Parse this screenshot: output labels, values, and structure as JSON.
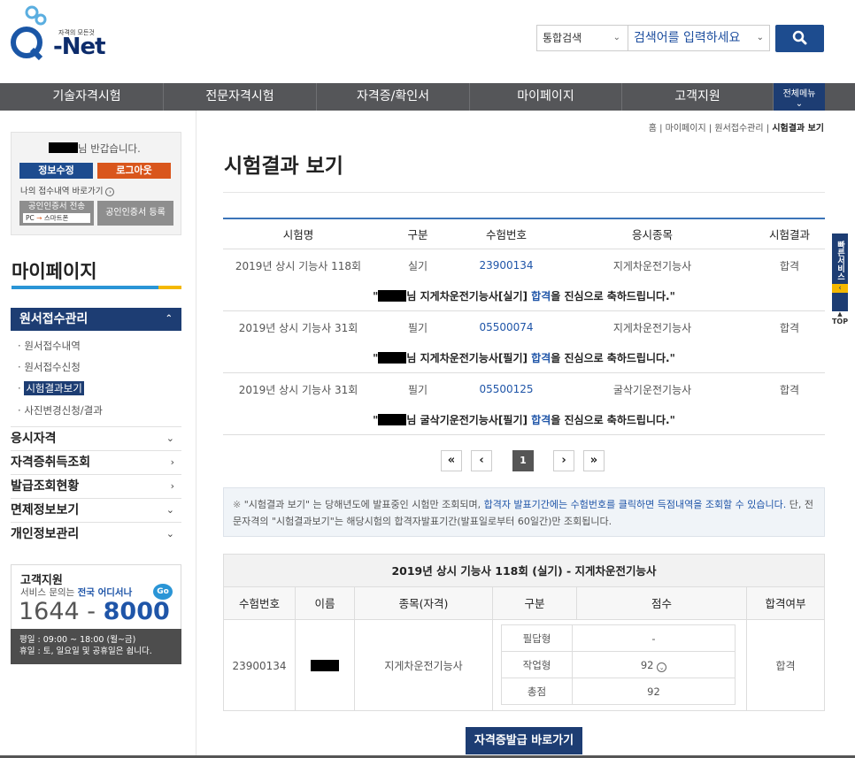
{
  "header": {
    "logo_tag": "자격의 모든것",
    "logo_q": "Q",
    "logo_text": "-Net",
    "search_select": "통합검색",
    "search_placeholder": "검색어를 입력하세요"
  },
  "gnb": {
    "items": [
      "기술자격시험",
      "전문자격시험",
      "자격증/확인서",
      "마이페이지",
      "고객지원"
    ],
    "all_menu": "전체메뉴"
  },
  "left": {
    "greeting": "님 반갑습니다.",
    "edit_button": "정보수정",
    "logout_button": "로그아웃",
    "my_receipt_link": "나의 접수내역 바로가기",
    "cert_send_button": "공인인증서 전송",
    "cert_send_sub_pc": "PC",
    "cert_send_sub_phone": "스마트폰",
    "cert_register_button": "공인인증서 등록",
    "lnb_title": "마이페이지",
    "active_menu": "원서접수관리",
    "sub_items": [
      "원서접수내역",
      "원서접수신청",
      "시험결과보기",
      "사진변경신청/결과"
    ],
    "menus": [
      "응시자격",
      "자격증취득조회",
      "발급조회현황",
      "면제정보보기",
      "개인정보관리"
    ],
    "cs": {
      "title": "고객지원",
      "desc_prefix": "서비스 문의는 ",
      "desc_highlight": "전국 어디서나",
      "go_badge": "Go",
      "phone_prefix": "1644 - ",
      "phone_suffix": "8000",
      "hours": "평일 : 09:00 ~ 18:00 (월~금)",
      "holiday": "휴일 : 토, 일요일 및 공휴일은 쉽니다."
    }
  },
  "main": {
    "breadcrumb": [
      "홈",
      "마이페이지",
      "원서접수관리",
      "시험결과 보기"
    ],
    "title": "시험결과 보기",
    "table_headers": [
      "시험명",
      "구분",
      "수험번호",
      "응시종목",
      "시험결과"
    ],
    "results": [
      {
        "exam": "2019년 상시 기능사 118회",
        "type": "실기",
        "number": "23900134",
        "subject": "지게차운전기능사",
        "result": "합격",
        "msg_pre": "님 지게차운전기능사[실기] ",
        "msg_pass": "합격",
        "msg_post": "을 진심으로 축하드립니다."
      },
      {
        "exam": "2019년 상시 기능사 31회",
        "type": "필기",
        "number": "05500074",
        "subject": "지게차운전기능사",
        "result": "합격",
        "msg_pre": "님 지게차운전기능사[필기] ",
        "msg_pass": "합격",
        "msg_post": "을 진심으로 축하드립니다."
      },
      {
        "exam": "2019년 상시 기능사 31회",
        "type": "필기",
        "number": "05500125",
        "subject": "굴삭기운전기능사",
        "result": "합격",
        "msg_pre": "님 굴삭기운전기능사[필기] ",
        "msg_pass": "합격",
        "msg_post": "을 진심으로 축하드립니다."
      }
    ],
    "pager": {
      "first": "«",
      "prev": "‹",
      "current": "1",
      "next": "›",
      "last": "»"
    },
    "notice": {
      "mark": "※",
      "part1": "\"시험결과 보기\" 는 당해년도에 발표중인 시험만 조회되며, ",
      "part2": "합격자 발표기간에는 수험번호를 클릭하면 득점내역을 조회할 수 있습니다.",
      "part3": " 단, 전문자격의 \"시험결과보기\"는 해당시험의 합격자발표기간(발표일로부터 60일간)만 조회됩니다."
    },
    "detail": {
      "title": "2019년 상시 기능사 118회 (실기) - 지게차운전기능사",
      "headers": [
        "수험번호",
        "이름",
        "종목(자격)",
        "구분",
        "점수",
        "합격여부"
      ],
      "number": "23900134",
      "subject": "지게차운전기능사",
      "pass": "합격",
      "scores": [
        {
          "label": "필답형",
          "value": "-"
        },
        {
          "label": "작업형",
          "value": "92"
        },
        {
          "label": "총점",
          "value": "92"
        }
      ]
    },
    "cert_button": "자격증발급 바로가기"
  },
  "side": {
    "quick": "빠른서비스",
    "top": "TOP"
  }
}
